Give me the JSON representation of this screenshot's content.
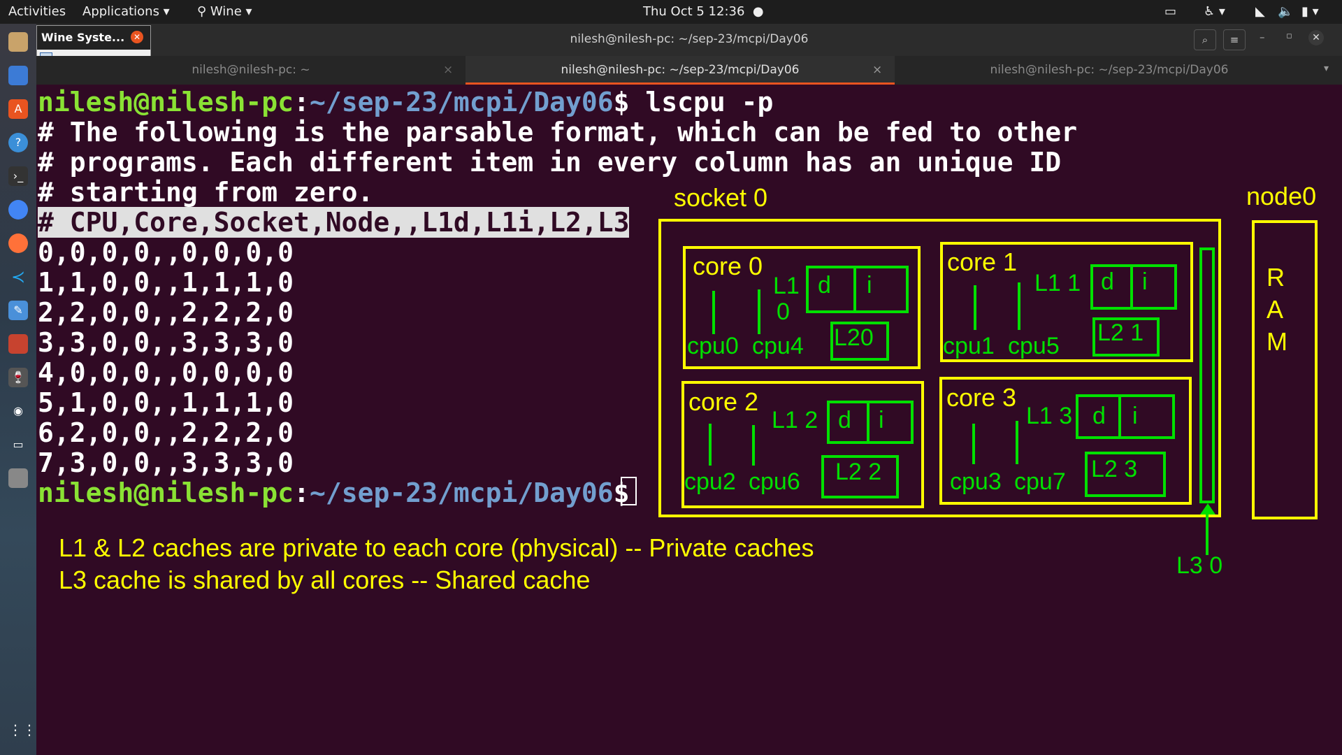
{
  "topbar": {
    "activities": "Activities",
    "applications": "Applications",
    "wine": "Wine",
    "datetime": "Thu Oct 5  12:36"
  },
  "wine_popup": {
    "title": "Wine Syste..."
  },
  "window": {
    "title": "nilesh@nilesh-pc: ~/sep-23/mcpi/Day06",
    "tabs": [
      {
        "label": "nilesh@nilesh-pc: ~"
      },
      {
        "label": "nilesh@nilesh-pc: ~/sep-23/mcpi/Day06"
      },
      {
        "label": "nilesh@nilesh-pc: ~/sep-23/mcpi/Day06"
      }
    ]
  },
  "terminal": {
    "prompt_user": "nilesh@nilesh-pc",
    "prompt_colon": ":",
    "prompt_path": "~/sep-23/mcpi/Day06",
    "prompt_dollar": "$",
    "command": " lscpu -p",
    "comment1": "# The following is the parsable format, which can be fed to other",
    "comment2": "# programs. Each different item in every column has an unique ID",
    "comment3": "# starting from zero.",
    "header": "# CPU,Core,Socket,Node,,L1d,L1i,L2,L3",
    "rows": [
      "0,0,0,0,,0,0,0,0",
      "1,1,0,0,,1,1,1,0",
      "2,2,0,0,,2,2,2,0",
      "3,3,0,0,,3,3,3,0",
      "4,0,0,0,,0,0,0,0",
      "5,1,0,0,,1,1,1,0",
      "6,2,0,0,,2,2,2,0",
      "7,3,0,0,,3,3,3,0"
    ]
  },
  "diagram": {
    "socket_label": "socket 0",
    "node_label": "node0",
    "ram_letters": [
      "R",
      "A",
      "M"
    ],
    "l3_label": "L3 0",
    "cores": [
      {
        "name": "core 0",
        "l1": "L1",
        "l1b": "0",
        "d": "d",
        "i": "i",
        "l2": "L20",
        "cpu_a": "cpu0",
        "cpu_b": "cpu4"
      },
      {
        "name": "core 1",
        "l1": "L1 1",
        "d": "d",
        "i": "i",
        "l2": "L2 1",
        "cpu_a": "cpu1",
        "cpu_b": "cpu5"
      },
      {
        "name": "core 2",
        "l1": "L1 2",
        "d": "d",
        "i": "i",
        "l2": "L2 2",
        "cpu_a": "cpu2",
        "cpu_b": "cpu6"
      },
      {
        "name": "core 3",
        "l1": "L1 3",
        "d": "d",
        "i": "i",
        "l2": "L2 3",
        "cpu_a": "cpu3",
        "cpu_b": "cpu7"
      }
    ],
    "notes": [
      "L1 & L2 caches are private to each core (physical) -- Private caches",
      "L3 cache is shared by all cores -- Shared cache"
    ]
  },
  "colors": {
    "terminal_bg": "#300a24",
    "annotation_yellow": "#ffff00",
    "annotation_green": "#00e000",
    "prompt_green": "#8ae234",
    "prompt_blue": "#729fcf"
  }
}
